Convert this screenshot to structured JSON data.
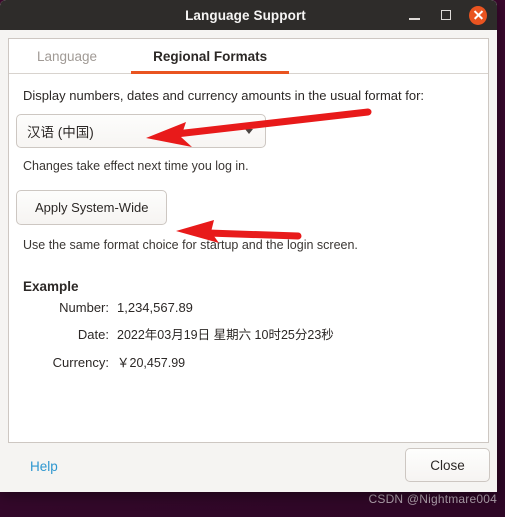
{
  "window": {
    "title": "Language Support",
    "controls": {
      "minimize": "minimize-icon",
      "maximize": "maximize-icon",
      "close": "close-icon"
    },
    "accent_color": "#e95420",
    "titlebar_color": "#2e2c2a"
  },
  "tabs": [
    {
      "label": "Language",
      "active": false
    },
    {
      "label": "Regional Formats",
      "active": true
    }
  ],
  "regional": {
    "intro": "Display numbers, dates and currency amounts in the usual format for:",
    "locale_selected": "汉语 (中国)",
    "locale_hint": "Changes take effect next time you log in.",
    "apply_label": "Apply System-Wide",
    "apply_hint": "Use the same format choice for startup and the login screen.",
    "example": {
      "title": "Example",
      "rows": [
        {
          "label": "Number:",
          "value": "1,234,567.89"
        },
        {
          "label": "Date:",
          "value": "2022年03月19日 星期六 10时25分23秒"
        },
        {
          "label": "Currency:",
          "value": "￥20,457.99"
        }
      ]
    }
  },
  "footer": {
    "help_label": "Help",
    "close_label": "Close"
  },
  "annotations": {
    "arrow_color": "#e81a1a",
    "arrow_1_target": "locale-dropdown",
    "arrow_2_target": "apply-system-wide-button"
  },
  "desktop": {
    "watermark": "CSDN @Nightmare004",
    "background_color": "#3a0b32"
  }
}
